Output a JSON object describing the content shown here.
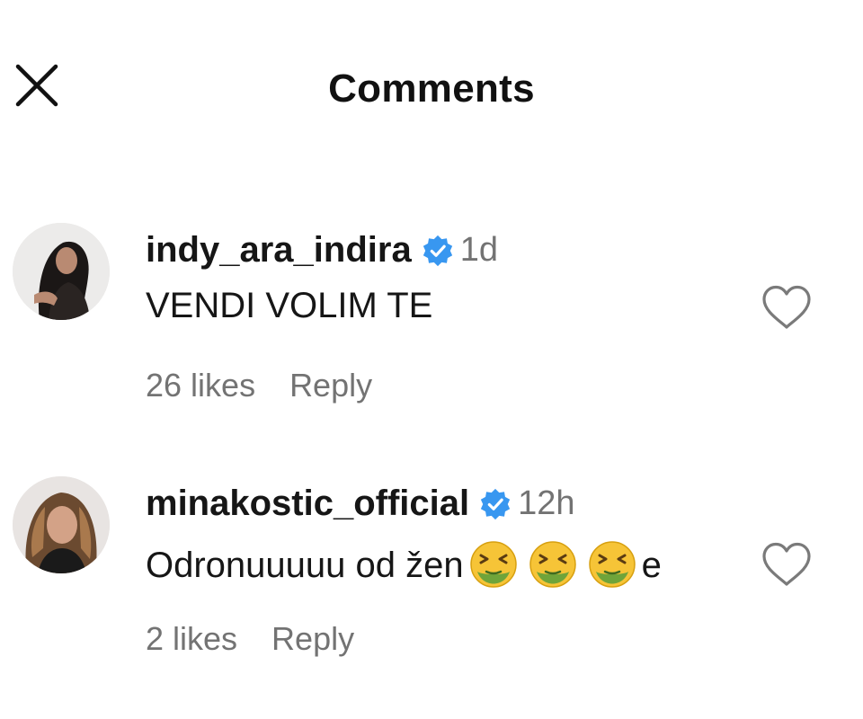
{
  "header": {
    "title": "Comments",
    "close_icon": "close-icon"
  },
  "comments": [
    {
      "username": "indy_ara_indira",
      "verified": true,
      "time": "1d",
      "text": "VENDI VOLIM TE",
      "likes": "26 likes",
      "reply_label": "Reply",
      "like_icon": "heart-outline-icon"
    },
    {
      "username": "minakostic_official",
      "verified": true,
      "time": "12h",
      "text_before": "Odronuuuuu od žen",
      "emojis": [
        "nauseated-face-emoji",
        "nauseated-face-emoji",
        "nauseated-face-emoji"
      ],
      "text_after": "e",
      "likes": "2 likes",
      "reply_label": "Reply",
      "like_icon": "heart-outline-icon"
    }
  ],
  "colors": {
    "verified_badge": "#3897f0",
    "secondary_text": "#737373",
    "primary_text": "#161616"
  }
}
